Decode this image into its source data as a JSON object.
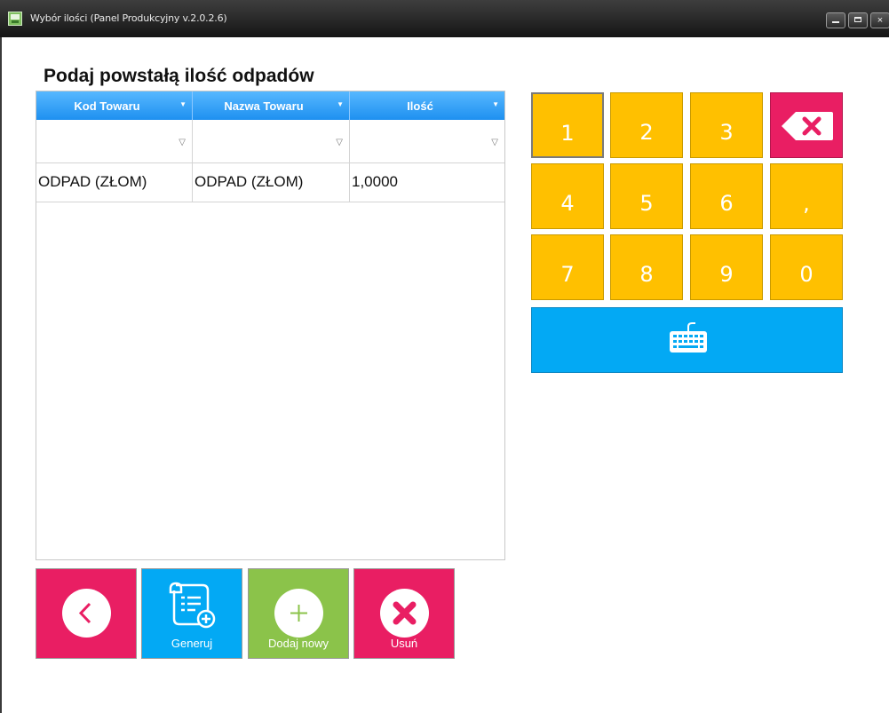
{
  "window": {
    "title": "Wybór ilości (Panel Produkcyjny v.2.0.2.6)",
    "controls": {
      "minimize": "",
      "maximize": "",
      "close": "×"
    }
  },
  "heading": "Podaj powstałą ilość odpadów",
  "grid": {
    "columns": [
      {
        "label": "Kod Towaru",
        "sort": "▼"
      },
      {
        "label": "Nazwa Towaru",
        "sort": "▼"
      },
      {
        "label": "Ilość",
        "sort": "▼"
      }
    ],
    "filter_icon": "▽",
    "rows": [
      {
        "code": "ODPAD (ZŁOM)",
        "name": "ODPAD (ZŁOM)",
        "qty": "1,0000"
      }
    ]
  },
  "actions": {
    "back": {
      "label": "",
      "icon": "chevron-left-icon"
    },
    "generate": {
      "label": "Generuj",
      "icon": "document-add-icon"
    },
    "add_new": {
      "label": "Dodaj nowy",
      "icon": "plus-icon"
    },
    "delete": {
      "label": "Usuń",
      "icon": "close-circle-icon"
    }
  },
  "keypad": {
    "keys": [
      "1",
      "2",
      "3",
      "",
      "4",
      "5",
      "6",
      ",",
      "7",
      "8",
      "9",
      "0"
    ],
    "backspace_icon": "backspace-icon",
    "keyboard_icon": "keyboard-icon"
  },
  "colors": {
    "keypad_yellow": "#ffc000",
    "pink": "#e91e63",
    "blue": "#03a9f4",
    "green": "#8bc34a",
    "grid_header": "#2196f3"
  }
}
